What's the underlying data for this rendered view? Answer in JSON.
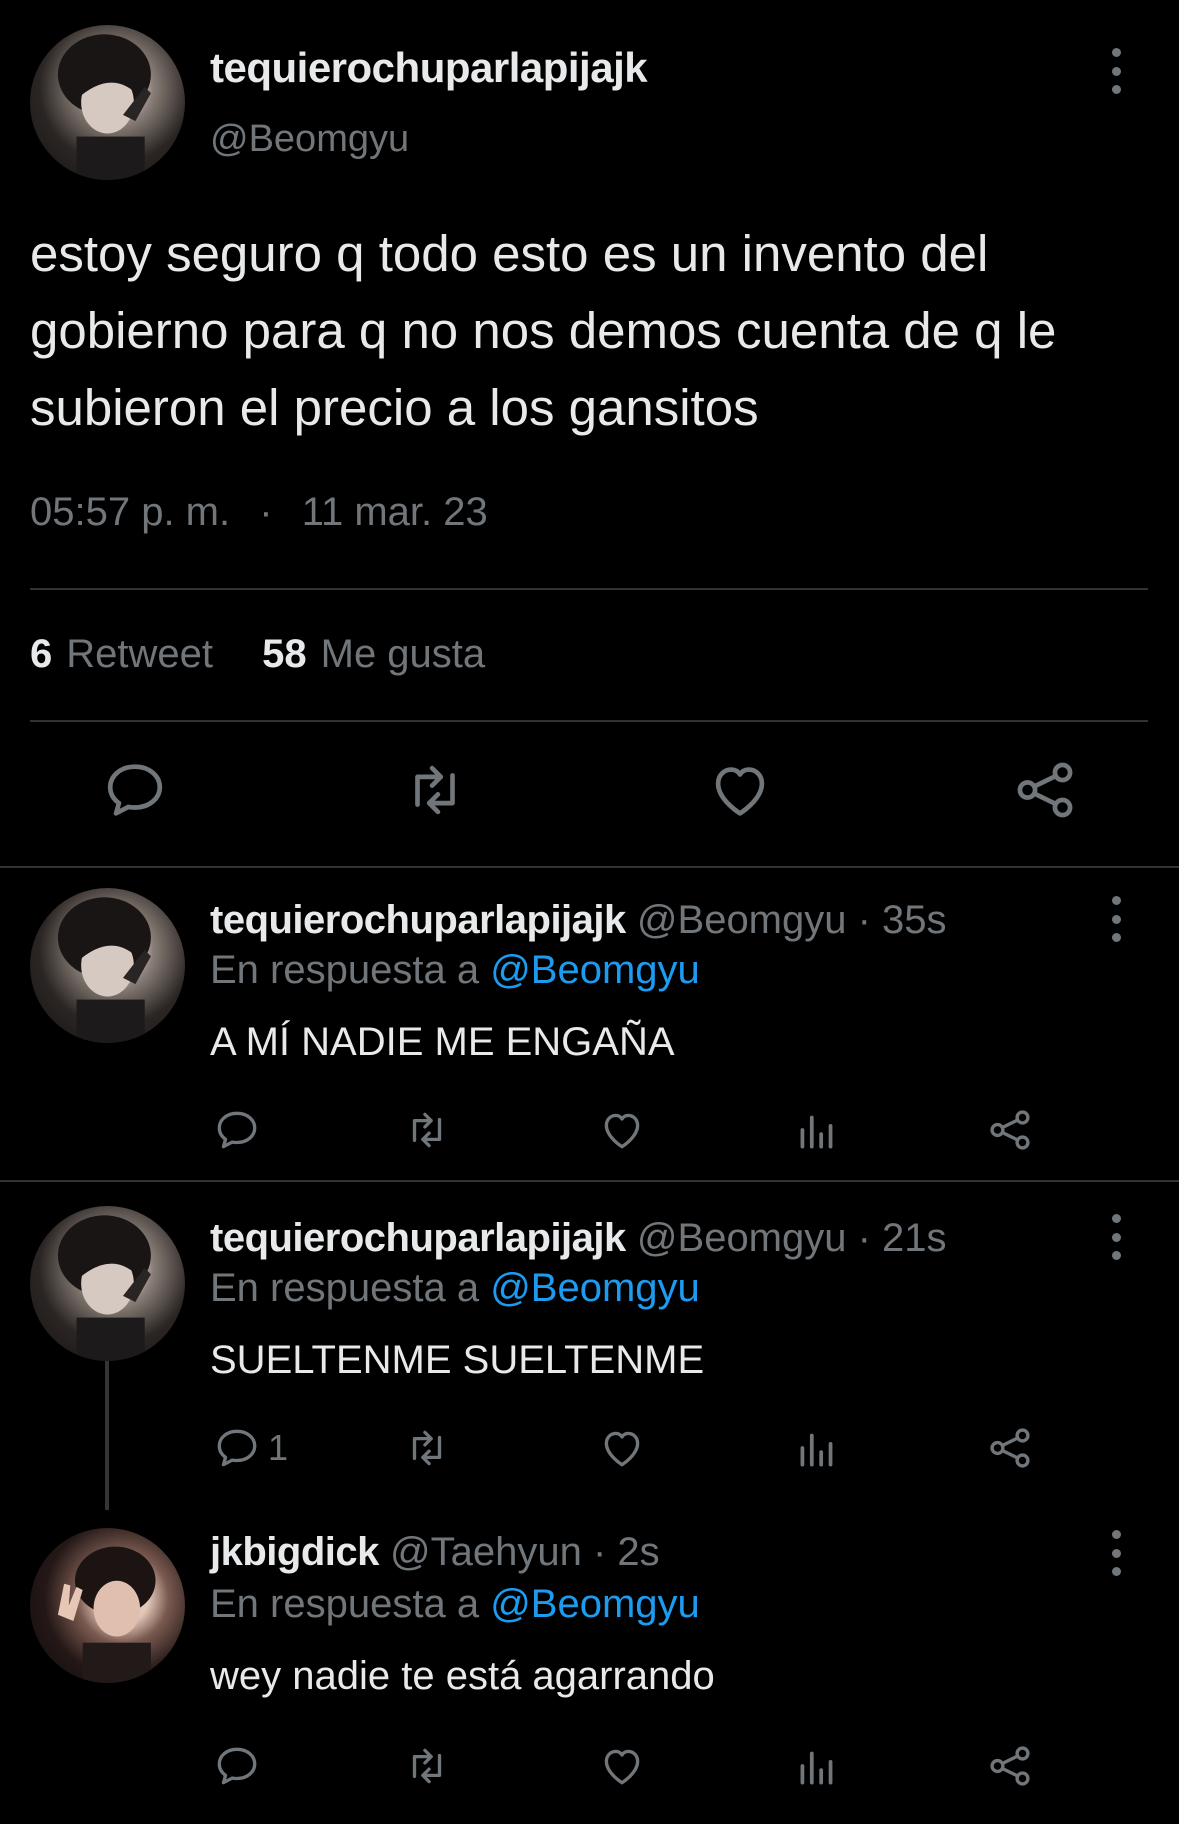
{
  "main_tweet": {
    "author_name": "tequierochuparlapijajk",
    "author_handle": "@Beomgyu",
    "text": "estoy seguro q todo esto es un invento del gobierno para q no nos demos cuenta de q le subieron el precio a los gansitos",
    "time": "05:57 p. m.",
    "separator": "·",
    "date": "11 mar. 23",
    "retweet_count": "6",
    "retweet_label": "Retweet",
    "like_count": "58",
    "like_label": "Me gusta"
  },
  "replies": [
    {
      "author_name": "tequierochuparlapijajk",
      "author_handle_meta": "@Beomgyu · 35s",
      "reply_to_label": "En respuesta a",
      "reply_to_handle": "@Beomgyu",
      "text": "A MÍ NADIE ME ENGAÑA",
      "reply_count": ""
    },
    {
      "author_name": "tequierochuparlapijajk",
      "author_handle_meta": "@Beomgyu · 21s",
      "reply_to_label": "En respuesta a",
      "reply_to_handle": "@Beomgyu",
      "text": "SUELTENME SUELTENME",
      "reply_count": "1"
    },
    {
      "author_name": "jkbigdick",
      "author_handle_meta": "@Taehyun · 2s",
      "reply_to_label": "En respuesta a",
      "reply_to_handle": "@Beomgyu",
      "text": "wey nadie te está agarrando",
      "reply_count": ""
    }
  ],
  "icons": {
    "reply": "reply-icon",
    "retweet": "retweet-icon",
    "like": "heart-icon",
    "views": "analytics-icon",
    "share": "share-icon",
    "more": "more-vertical-icon"
  },
  "colors": {
    "background": "#000000",
    "text": "#e7e9ea",
    "muted": "#71767b",
    "mention": "#1d9bf0",
    "divider": "#2f3336"
  }
}
